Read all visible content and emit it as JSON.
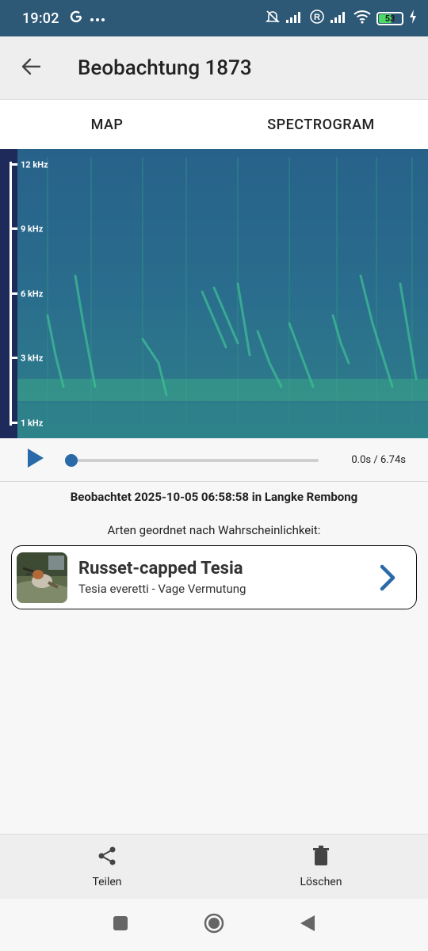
{
  "status_bar": {
    "time": "19:02",
    "left_icons": [
      "google-g-icon",
      "more-dots-icon"
    ],
    "right_icons": [
      "mute-icon",
      "signal-icon",
      "roaming-r-icon",
      "signal-icon",
      "wifi-icon",
      "battery-icon",
      "charging-icon"
    ],
    "battery_level": "53"
  },
  "app_bar": {
    "title": "Beobachtung 1873",
    "back_icon": "arrow-back-icon"
  },
  "tabs": [
    {
      "label": "MAP"
    },
    {
      "label": "SPECTROGRAM"
    }
  ],
  "spectrogram": {
    "frequency_labels": [
      "12 kHz",
      "9 kHz",
      "6 kHz",
      "3 kHz",
      "1 kHz"
    ]
  },
  "player": {
    "time_readout": "0.0s / 6.74s",
    "progress": 0,
    "accent": "#2a6aa8"
  },
  "observation": {
    "observed_text": "Beobachtet 2025-10-05 06:58:58 in Langke Rembong",
    "species_heading": "Arten geordnet nach Wahrscheinlichkeit:"
  },
  "species": [
    {
      "common_name": "Russet-capped Tesia",
      "subtitle": "Tesia everetti - Vage Vermutung"
    }
  ],
  "actions": {
    "share_label": "Teilen",
    "delete_label": "Löschen"
  },
  "colors": {
    "status_bar": "#2d5876",
    "spectrogram_bg": "#2a6b8e",
    "accent": "#2a6aa8"
  }
}
